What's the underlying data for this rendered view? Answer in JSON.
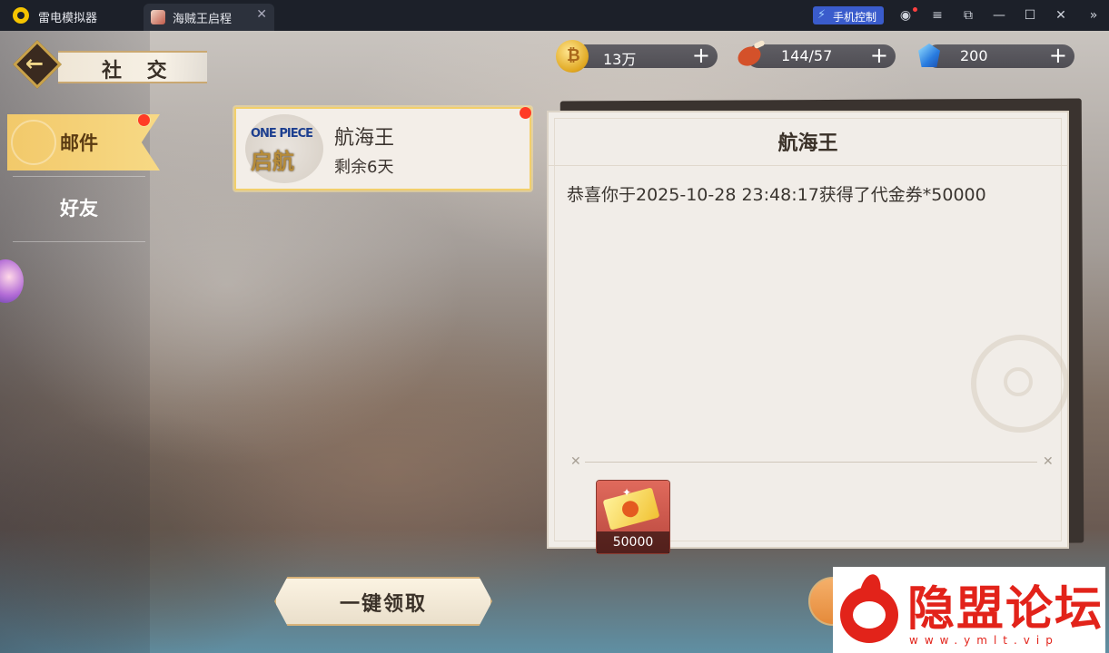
{
  "emulator": {
    "app_name": "雷电模拟器",
    "tab_title": "海贼王启程",
    "phone_control_label": "手机控制"
  },
  "header": {
    "title": "社 交"
  },
  "currencies": [
    {
      "icon": "gold-coin-icon",
      "value": "13万"
    },
    {
      "icon": "meat-stamina-icon",
      "value": "144/57"
    },
    {
      "icon": "diamond-gem-icon",
      "value": "200"
    }
  ],
  "nav": {
    "items": [
      {
        "label": "邮件",
        "active": true,
        "has_notification": true
      },
      {
        "label": "好友",
        "active": false,
        "has_notification": false
      }
    ]
  },
  "mail_list": [
    {
      "logo_text_top": "ONE PIECE",
      "logo_text_bottom": "启航",
      "sender": "航海王",
      "remaining": "剩余6天",
      "unread": true
    }
  ],
  "mail_detail": {
    "title": "航海王",
    "body": "恭喜你于2025-10-28 23:48:17获得了代金券*50000",
    "attachments": [
      {
        "icon": "voucher-ticket-icon",
        "count": "50000"
      }
    ]
  },
  "actions": {
    "collect_all_label": "一键领取"
  },
  "watermark": {
    "text": "隐盟论坛",
    "url": "www.ymlt.vip"
  },
  "colors": {
    "accent_gold": "#f2c96a",
    "notification_red": "#ff3b26",
    "panel_bg": "#f1ede8",
    "watermark_red": "#e2231a"
  }
}
